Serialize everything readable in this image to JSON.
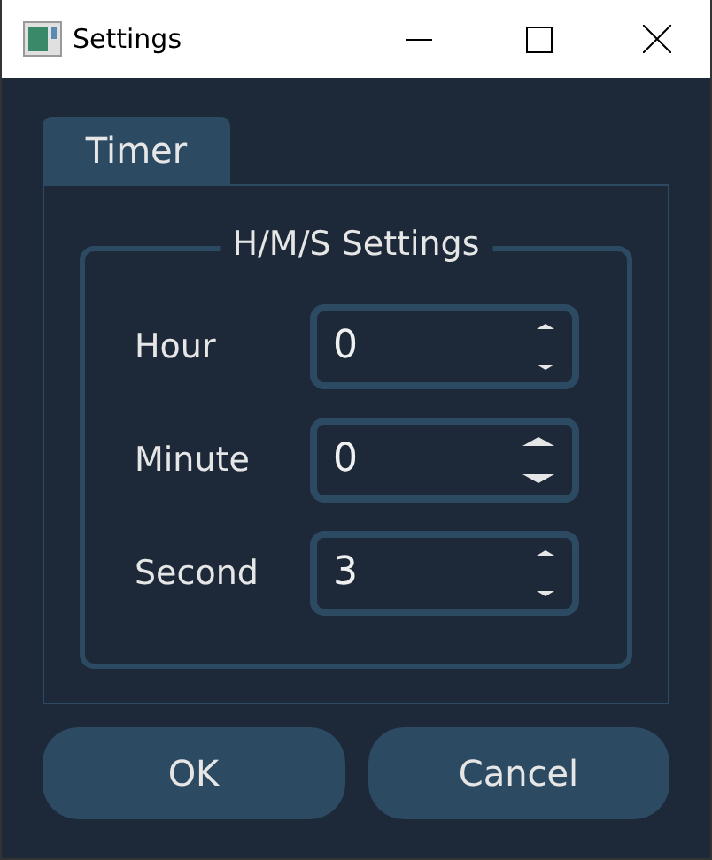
{
  "window": {
    "title": "Settings"
  },
  "tabs": [
    {
      "label": "Timer",
      "selected": true
    }
  ],
  "group": {
    "title": "H/M/S Settings"
  },
  "fields": [
    {
      "label": "Hour",
      "value": "0",
      "hovered": false
    },
    {
      "label": "Minute",
      "value": "0",
      "hovered": true
    },
    {
      "label": "Second",
      "value": "3",
      "hovered": false
    }
  ],
  "buttons": [
    "OK",
    "Cancel"
  ]
}
